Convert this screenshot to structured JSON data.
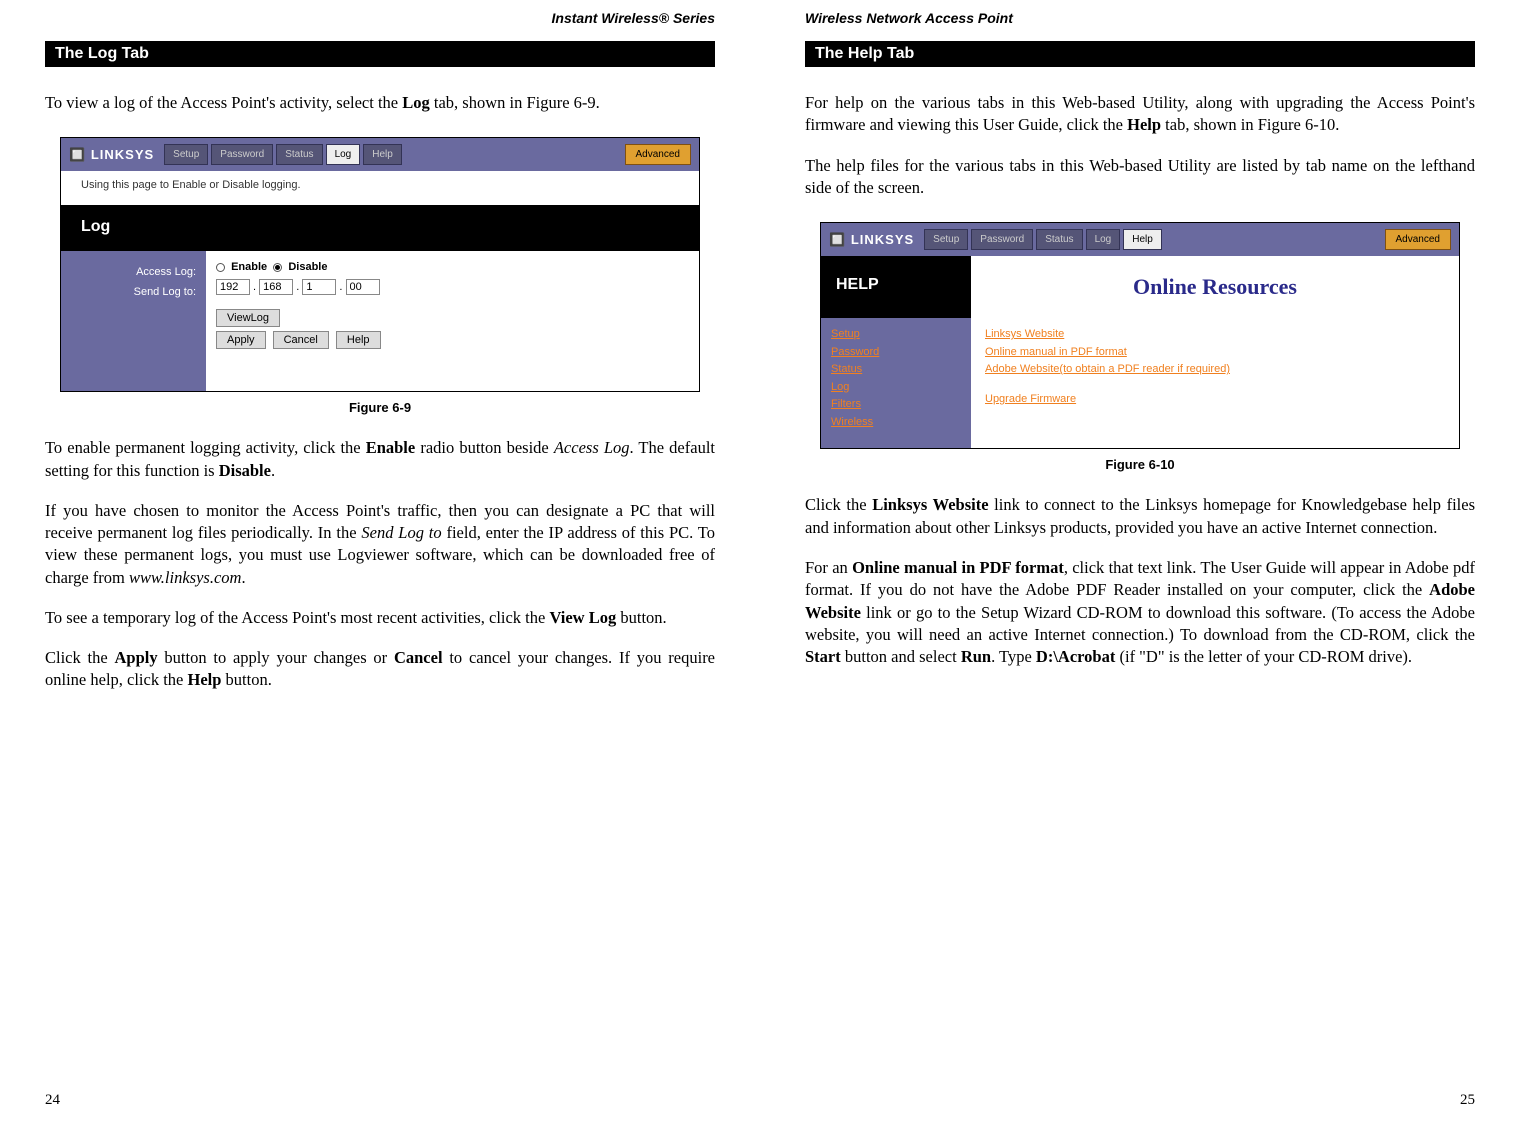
{
  "left": {
    "header": "Instant Wireless® Series",
    "section": "The Log Tab",
    "para1_a": "To view a log of the Access Point's activity, select the ",
    "para1_b": "Log",
    "para1_c": " tab, shown in Figure 6-9.",
    "fig_caption": "Figure 6-9",
    "para2_a": "To enable permanent logging activity, click the ",
    "para2_b": "Enable",
    "para2_c": " radio button beside ",
    "para2_d": "Access Log",
    "para2_e": ". The default setting for this function is ",
    "para2_f": "Disable",
    "para2_g": ".",
    "para3_a": "If you have chosen to monitor the Access Point's traffic, then you can designate a PC that will receive permanent log files periodically. In the ",
    "para3_b": "Send Log to",
    "para3_c": " field, enter the IP address of this PC. To view these permanent logs, you must use Logviewer software, which can be downloaded free of charge from ",
    "para3_d": "www.linksys.com",
    "para3_e": ".",
    "para4_a": "To see a temporary log of the Access Point's most recent activities, click the ",
    "para4_b": "View Log",
    "para4_c": " button.",
    "para5_a": "Click the ",
    "para5_b": "Apply",
    "para5_c": " button to apply your changes or ",
    "para5_d": "Cancel",
    "para5_e": " to cancel your changes. If you require online help, click the ",
    "para5_f": "Help",
    "para5_g": " button.",
    "page_num": "24"
  },
  "right": {
    "header": "Wireless Network Access Point",
    "section": "The Help Tab",
    "para1_a": "For help on the various tabs in this Web-based Utility, along with upgrading the Access Point's firmware and viewing this User Guide, click the ",
    "para1_b": "Help",
    "para1_c": " tab, shown in Figure 6-10.",
    "para2": "The help files for the various tabs in this Web-based Utility are listed by tab name on the lefthand side of the screen.",
    "fig_caption": "Figure 6-10",
    "para3_a": "Click the ",
    "para3_b": "Linksys Website",
    "para3_c": " link to connect to the Linksys homepage for Knowledgebase help files and information about other Linksys products, provided you have an active Internet connection.",
    "para4_a": "For an ",
    "para4_b": "Online manual in PDF format",
    "para4_c": ", click that text link. The User Guide will appear in Adobe pdf format. If you do not have the Adobe PDF Reader installed on your computer, click the ",
    "para4_d": "Adobe Website",
    "para4_e": " link or go to the Setup Wizard CD-ROM to download this software. (To access the Adobe website, you will need an active Internet connection.) To download from the CD-ROM, click the ",
    "para4_f": "Start",
    "para4_g": " button and select ",
    "para4_h": "Run",
    "para4_i": ". Type ",
    "para4_j": "D:\\Acrobat",
    "para4_k": " (if \"D\" is the letter of your CD-ROM drive).",
    "page_num": "25"
  },
  "fig69": {
    "logo": "LINKSYS",
    "tabs": [
      "Setup",
      "Password",
      "Status",
      "Log",
      "Help"
    ],
    "active_tab": "Log",
    "advanced": "Advanced",
    "desc": "Using this page to Enable or Disable logging.",
    "section_label": "Log",
    "label_access": "Access Log:",
    "label_sendto": "Send Log to:",
    "radio_enable": "Enable",
    "radio_disable": "Disable",
    "ip": [
      "192",
      "168",
      "1",
      "00"
    ],
    "btn_viewlog": "ViewLog",
    "btn_apply": "Apply",
    "btn_cancel": "Cancel",
    "btn_help": "Help"
  },
  "fig610": {
    "logo": "LINKSYS",
    "tabs": [
      "Setup",
      "Password",
      "Status",
      "Log",
      "Help"
    ],
    "active_tab": "Help",
    "advanced": "Advanced",
    "help_label": "HELP",
    "title": "Online Resources",
    "menu": [
      "Setup",
      "Password",
      "Status",
      "Log",
      "Filters",
      "Wireless"
    ],
    "links": [
      "Linksys Website",
      "Online manual in PDF format",
      "Adobe Website(to obtain a PDF reader if required)"
    ],
    "link_upgrade": "Upgrade Firmware"
  }
}
